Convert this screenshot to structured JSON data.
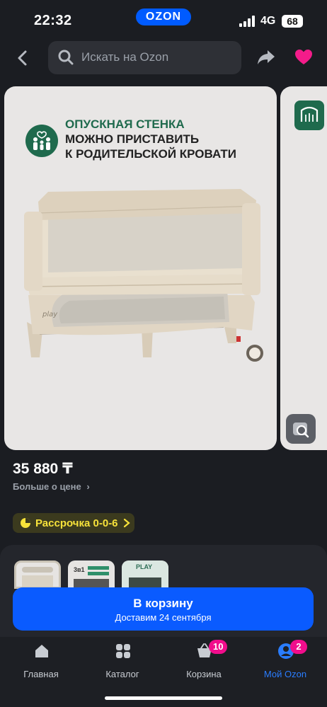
{
  "status_bar": {
    "time": "22:32",
    "network": "4G",
    "battery": "68",
    "logo": "OZON"
  },
  "search": {
    "placeholder": "Искать на Ozon"
  },
  "gallery": {
    "banner_line1": "ОПУСКНАЯ СТЕНКА",
    "banner_line2": "МОЖНО ПРИСТАВИТЬ",
    "banner_line3": "К РОДИТЕЛЬСКОЙ КРОВАТИ"
  },
  "price": {
    "value": "35 880 ₸",
    "more_label": "Больше о цене"
  },
  "installment": {
    "label": "Рассрочка 0-0-6"
  },
  "thumbnails": [
    "thumb-1",
    "thumb-2",
    "thumb-3"
  ],
  "thumbnail_text": {
    "t2_title": "3в1",
    "t3_title": "PLAY"
  },
  "cta": {
    "title": "В корзину",
    "subtitle": "Доставим 24 сентября"
  },
  "tabs": [
    {
      "label": "Главная",
      "icon": "home-icon"
    },
    {
      "label": "Каталог",
      "icon": "catalog-icon"
    },
    {
      "label": "Корзина",
      "icon": "cart-icon",
      "badge": "10"
    },
    {
      "label": "Мой Ozon",
      "icon": "profile-icon",
      "badge": "2",
      "active": true
    }
  ],
  "colors": {
    "accent": "#005bff",
    "badge": "#f10d8c",
    "banner_green": "#1f6a4d",
    "installment_text": "#f7e23a"
  }
}
